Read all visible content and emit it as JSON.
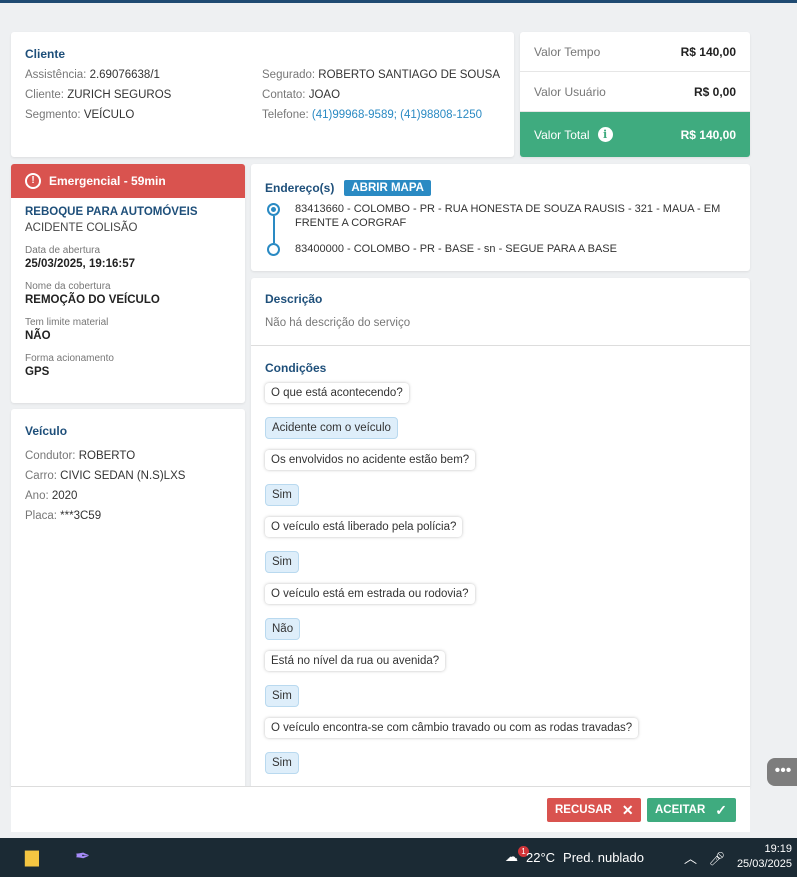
{
  "client": {
    "title": "Cliente",
    "assistencia_label": "Assistência:",
    "assistencia": "2.69076638/1",
    "cliente_label": "Cliente:",
    "cliente": "ZURICH SEGUROS",
    "segmento_label": "Segmento:",
    "segmento": "VEÍCULO",
    "segurado_label": "Segurado:",
    "segurado": "ROBERTO SANTIAGO DE SOUSA",
    "contato_label": "Contato:",
    "contato": "JOAO",
    "telefone_label": "Telefone:",
    "telefone": "(41)99968-9589; (41)98808-1250"
  },
  "values": {
    "tempo_label": "Valor Tempo",
    "tempo": "R$ 140,00",
    "usuario_label": "Valor Usuário",
    "usuario": "R$ 0,00",
    "total_label": "Valor Total",
    "total": "R$ 140,00",
    "total_color": "#3fab7f"
  },
  "service": {
    "emergency": "Emergencial - 59min",
    "emergency_color": "#d9534f",
    "type": "REBOQUE PARA AUTOMÓVEIS",
    "subtype": "ACIDENTE COLISÃO",
    "fields": [
      {
        "label": "Data de abertura",
        "value": "25/03/2025, 19:16:57"
      },
      {
        "label": "Nome da cobertura",
        "value": "REMOÇÃO DO VEÍCULO"
      },
      {
        "label": "Tem limite material",
        "value": "NÃO"
      },
      {
        "label": "Forma acionamento",
        "value": "GPS"
      }
    ]
  },
  "vehicle": {
    "title": "Veículo",
    "condutor_label": "Condutor:",
    "condutor": "ROBERTO",
    "carro_label": "Carro:",
    "carro": "CIVIC SEDAN (N.S)LXS",
    "ano_label": "Ano:",
    "ano": "2020",
    "placa_label": "Placa:",
    "placa": "***3C59"
  },
  "address": {
    "title": "Endereço(s)",
    "map_button": "ABRIR MAPA",
    "origin": "83413660 - COLOMBO - PR - RUA HONESTA DE SOUZA RAUSIS - 321 - MAUA - EM FRENTE A CORGRAF",
    "destination": "83400000 - COLOMBO - PR - BASE - sn - SEGUE PARA A BASE"
  },
  "description": {
    "title": "Descrição",
    "text": "Não há descrição do serviço"
  },
  "conditions": {
    "title": "Condições",
    "items": [
      "O que está acontecendo?",
      "Acidente com o veículo",
      "Os envolvidos no acidente estão bem?",
      "Sim",
      "O veículo está liberado pela polícia?",
      "Sim",
      "O veículo está em estrada ou rodovia?",
      "Não",
      "Está no nível da rua ou avenida?",
      "Sim",
      "O veículo encontra-se com câmbio travado ou com as rodas travadas?",
      "Sim"
    ]
  },
  "footer": {
    "refuse": "RECUSAR",
    "accept": "ACEITAR"
  },
  "taskbar": {
    "temperature": "22°C",
    "weather": "Pred. nublado",
    "notification_count": "1",
    "time": "19:19",
    "date": "25/03/2025"
  }
}
